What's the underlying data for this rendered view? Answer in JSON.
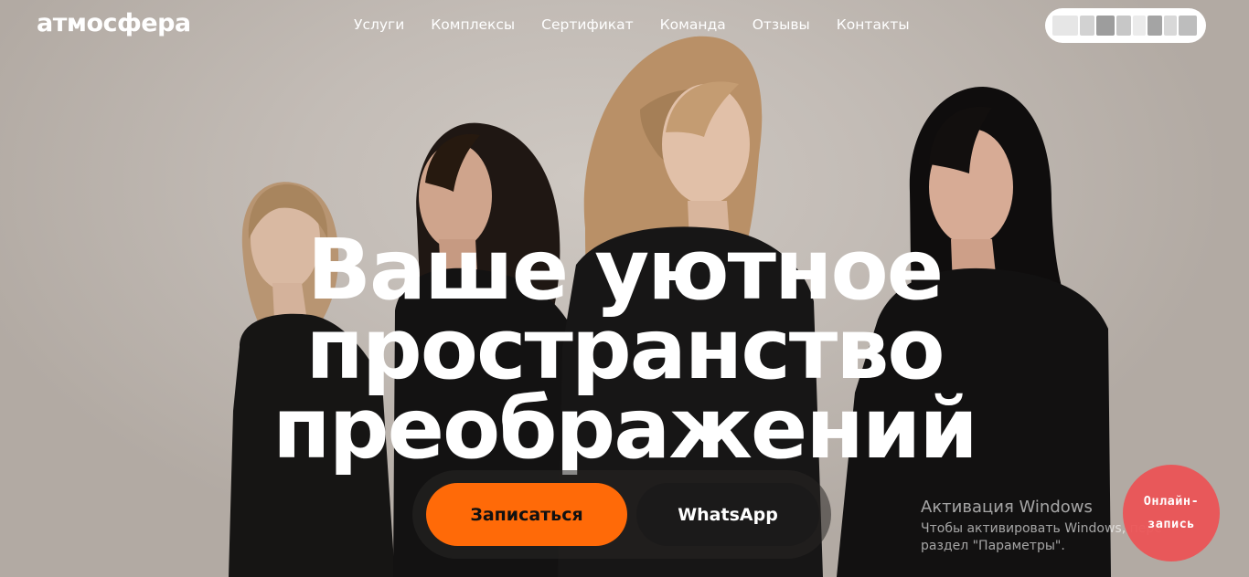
{
  "header": {
    "logo": "атмосфера",
    "nav": [
      "Услуги",
      "Комплексы",
      "Сертификат",
      "Команда",
      "Отзывы",
      "Контакты"
    ]
  },
  "hero": {
    "headline": [
      "Ваше уютное",
      "пространство",
      "преображений"
    ],
    "primary_button": "Записаться",
    "secondary_button": "WhatsApp",
    "colors": {
      "primary_button": "#ff6a08",
      "secondary_button": "#1b1a1a",
      "online_badge": "#ec5254"
    }
  },
  "windows_watermark": {
    "title": "Активация Windows",
    "line1": "Чтобы активировать Windows, пере",
    "line2": "раздел \"Параметры\"."
  },
  "online_badge": {
    "line1": "Онлайн-",
    "line2": "запись"
  }
}
